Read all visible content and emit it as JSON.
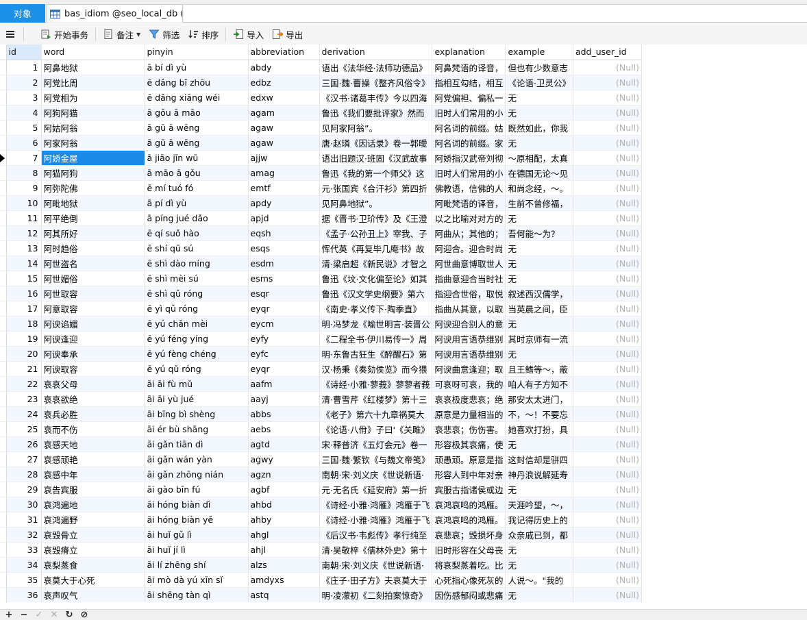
{
  "tabs": {
    "objects_label": "对象",
    "table_tab_label": "bas_idiom @seo_local_db (..."
  },
  "toolbar": {
    "menu_icon": "hamburger-icon",
    "begin_transaction": "开始事务",
    "memo": "备注",
    "filter": "筛选",
    "sort": "排序",
    "import": "导入",
    "export": "导出"
  },
  "grid": {
    "columns": [
      "id",
      "word",
      "pinyin",
      "abbreviation",
      "derivation",
      "explanation",
      "example",
      "add_user_id"
    ],
    "current_row_index": 6,
    "null_text": "(Null)",
    "rows": [
      [
        "1",
        "阿鼻地狱",
        "ā bí dì yù",
        "abdy",
        "语出《法华经·法师功德品》",
        "阿鼻梵语的译音，",
        "但也有少数意志",
        "(Null)"
      ],
      [
        "2",
        "阿党比周",
        "ē dǎng bǐ zhōu",
        "edbz",
        "三国·魏·曹操《整齐风俗令》",
        "指相互勾结，相互",
        "《论语·卫灵公》",
        "(Null)"
      ],
      [
        "3",
        "阿党相为",
        "ē dǎng xiāng wéi",
        "edxw",
        "《汉书·诸葛丰传》今以四海",
        "阿党偏袒、偏私一",
        "无",
        "(Null)"
      ],
      [
        "4",
        "阿狗阿猫",
        "ā gǒu ā māo",
        "agam",
        "鲁迅《我们要批评家》然而",
        "旧时人们常用的小",
        "无",
        "(Null)"
      ],
      [
        "5",
        "阿姑阿翁",
        "ā gū ā wēng",
        "agaw",
        "见阿家阿翁”。",
        "阿名词的前缀。姑",
        "既然如此，你我",
        "(Null)"
      ],
      [
        "6",
        "阿家阿翁",
        "ā gū ā wēng",
        "agaw",
        "唐·赵璘《因话录》卷一郭曖",
        "阿名词的前缀。家",
        "无",
        "(Null)"
      ],
      [
        "7",
        "阿娇金屋",
        "ā jiāo jīn wū",
        "ajjw",
        "语出旧题汉·班固《汉武故事",
        "阿娇指汉武帝刘彻",
        "～原相配，太真",
        "(Null)"
      ],
      [
        "8",
        "阿猫阿狗",
        "ā māo ā gǒu",
        "amag",
        "鲁迅《我的第一个师父》这",
        "旧时人们常用的小",
        "在德国无论～见",
        "(Null)"
      ],
      [
        "9",
        "阿弥陀佛",
        "ē mí tuó fó",
        "emtf",
        "元·张国宾《合汗衫》第四折",
        "佛教语，信佛的人",
        "和尚念经，～。",
        "(Null)"
      ],
      [
        "10",
        "阿毗地狱",
        "ā pí dì yù",
        "apdy",
        "见阿鼻地狱”。",
        "阿毗梵语的译音，",
        "生前不曾修福，",
        "(Null)"
      ],
      [
        "11",
        "阿平绝倒",
        "ā píng jué dǎo",
        "apjd",
        "据《晋书·卫玠传》及《王澄",
        "以之比喻对对方的",
        "无",
        "(Null)"
      ],
      [
        "12",
        "阿其所好",
        "ē qí suǒ hào",
        "eqsh",
        "《孟子·公孙丑上》宰我、子",
        "阿曲从；其他的；",
        "吾何能～为？",
        "(Null)"
      ],
      [
        "13",
        "阿时趋俗",
        "ē shí qū sú",
        "esqs",
        "恽代英《再复毕几庵书》故",
        "阿迎合。迎合时尚",
        "无",
        "(Null)"
      ],
      [
        "14",
        "阿世盗名",
        "ē shì dào míng",
        "esdm",
        "清·梁启超《新民说》才智之",
        "阿世曲意博取世人",
        "无",
        "(Null)"
      ],
      [
        "15",
        "阿世媚俗",
        "ē shì mèi sú",
        "esms",
        "鲁迅《坟·文化偏至论》如其",
        "指曲意迎合当时社",
        "无",
        "(Null)"
      ],
      [
        "16",
        "阿世取容",
        "ē shì qǔ róng",
        "esqr",
        "鲁迅《汉文学史纲要》第六",
        "指迎合世俗，取悦",
        "叙述西汉儒学，",
        "(Null)"
      ],
      [
        "17",
        "阿意取容",
        "ē yì qǔ róng",
        "eyqr",
        "《南史·孝义传下·陶季直》",
        "指曲从其意，以取",
        "当英晨之间，臣",
        "(Null)"
      ],
      [
        "18",
        "阿谀谄媚",
        "ē yú chǎn mèi",
        "eycm",
        "明·冯梦龙《喻世明言·装晋公",
        "阿谀迎合别人的意",
        "无",
        "(Null)"
      ],
      [
        "19",
        "阿谀逢迎",
        "ē yú féng yíng",
        "eyfy",
        "《二程全书·伊川易传一》周",
        "阿谀用言语恭维别",
        "其时京师有一流",
        "(Null)"
      ],
      [
        "20",
        "阿谀奉承",
        "ē yú fèng chéng",
        "eyfc",
        "明·东鲁古狂生《醉醒石》第",
        "阿谀用言语恭维别",
        "无",
        "(Null)"
      ],
      [
        "21",
        "阿谀取容",
        "ē yú qǔ róng",
        "eyqr",
        "汉·杨秉《奏劾侯览》而今猥",
        "阿谀曲意逢迎；取",
        "且王鳍等～，蔽",
        "(Null)"
      ],
      [
        "22",
        "哀哀父母",
        "āi āi fù mǔ",
        "aafm",
        "《诗经·小雅·蓼莪》蓼蓼者莪",
        "可哀呀可哀，我的",
        "咱人有子方知不",
        "(Null)"
      ],
      [
        "23",
        "哀哀欲绝",
        "āi āi yù jué",
        "aayj",
        "清·曹雪芹《红楼梦》第十三",
        "哀哀极度悲哀；绝",
        "那安太太进门，",
        "(Null)"
      ],
      [
        "24",
        "哀兵必胜",
        "āi bīng bì shèng",
        "abbs",
        "《老子》第六十九章祸莫大",
        "原意是力量相当的",
        "不，～！不要忘",
        "(Null)"
      ],
      [
        "25",
        "哀而不伤",
        "āi ér bù shāng",
        "aebs",
        "《论语·八佾》子曰'《关雎》",
        "哀悲哀；伤伤害。",
        "她喜欢打扮，具",
        "(Null)"
      ],
      [
        "26",
        "哀感天地",
        "āi gǎn tiān dì",
        "agtd",
        "宋·释普济《五灯会元》卷一",
        "形容极其哀痛，使",
        "无",
        "(Null)"
      ],
      [
        "27",
        "哀感顽艳",
        "āi gǎn wán yàn",
        "agwy",
        "三国·魏·繁钦《与魏文帝笺》",
        "顽愚顽。原意是指",
        "这封信却是骈四",
        "(Null)"
      ],
      [
        "28",
        "哀感中年",
        "āi gǎn zhōng nián",
        "agzn",
        "南朝·宋·刘义庆《世说新语·",
        "形容人到中年对亲",
        "神丹浪说解延寿",
        "(Null)"
      ],
      [
        "29",
        "哀告宾服",
        "āi gào bīn fú",
        "agbf",
        "元·无名氏《延安府》第一折",
        "宾服古指诸侯或边",
        "无",
        "(Null)"
      ],
      [
        "30",
        "哀鸿遍地",
        "āi hóng biàn dì",
        "ahbd",
        "《诗经·小雅·鸿雁》鸿雁于飞",
        "哀鸿哀鸣的鸿雁。",
        "天涯吟望，～，",
        "(Null)"
      ],
      [
        "31",
        "哀鸿遍野",
        "āi hóng biàn yě",
        "ahby",
        "《诗经·小雅·鸿雁》鸿雁于飞",
        "哀鸿哀鸣的鸿雁。",
        "我记得历史上的",
        "(Null)"
      ],
      [
        "32",
        "哀毁骨立",
        "āi huǐ gǔ lì",
        "ahgl",
        "《后汉书·韦彪传》孝行纯至",
        "哀悲哀；毁损坏身",
        "众亲戚已到，都",
        "(Null)"
      ],
      [
        "33",
        "哀毁瘠立",
        "āi huǐ jí lì",
        "ahjl",
        "清·吴敬梓《儒林外史》第十",
        "旧时形容在父母丧",
        "无",
        "(Null)"
      ],
      [
        "34",
        "哀梨蒸食",
        "āi lí zhēng shí",
        "alzs",
        "南朝·宋·刘义庆《世说新语·",
        "将哀梨蒸着吃。比",
        "无",
        "(Null)"
      ],
      [
        "35",
        "哀莫大于心死",
        "āi mò dà yú xīn sǐ",
        "amdyxs",
        "《庄子·田子方》夫哀莫大于",
        "心死指心像死灰的",
        "人说～。\"我的",
        "(Null)"
      ],
      [
        "36",
        "哀声叹气",
        "āi shēng tàn qì",
        "astq",
        "明·凌濛初《二刻拍案惊奇》",
        "因伤感郁闷或悲痛",
        "无",
        "(Null)"
      ]
    ]
  },
  "statusbar": {
    "add": "+",
    "remove": "−",
    "apply": "✓",
    "cancel": "✕",
    "refresh": "↻",
    "stop": "⊘"
  },
  "colors": {
    "accent": "#1c8fe6",
    "selected_cell": "#1a8ae6",
    "alt_row": "#f3f8fe",
    "null_text": "#b0b0b0"
  }
}
